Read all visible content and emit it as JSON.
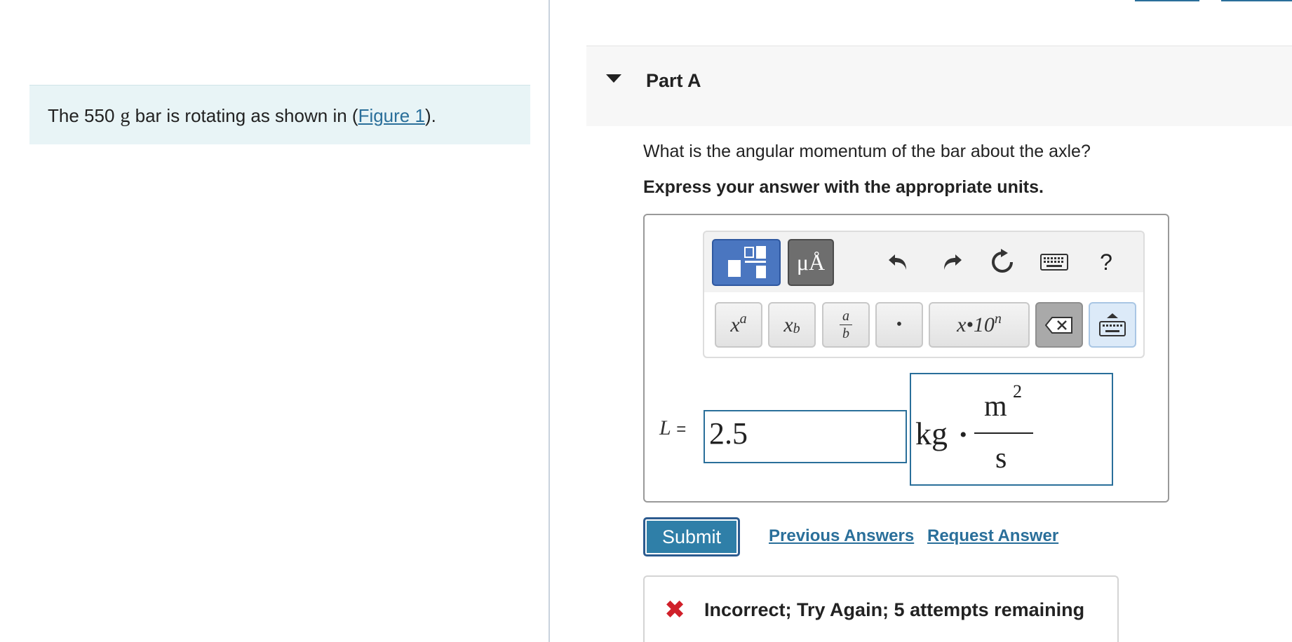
{
  "problem": {
    "intro_prefix": "The 550",
    "intro_unit": "g",
    "intro_middle": " bar is rotating as shown in (",
    "figure_link": "Figure 1",
    "intro_suffix": ")."
  },
  "part": {
    "title": "Part A",
    "question": "What is the angular momentum of the bar about the axle?",
    "instruction": "Express your answer with the appropriate units."
  },
  "toolbar": {
    "symbols_label": "μÅ",
    "help_label": "?",
    "keys": {
      "superscript_base": "x",
      "superscript_exp": "a",
      "subscript_base": "x",
      "subscript_sub": "b",
      "fraction_num": "a",
      "fraction_den": "b",
      "dot": "•",
      "sci_notation": "x•10",
      "sci_exp": "n"
    },
    "icons": [
      "templates-icon",
      "undo-icon",
      "redo-icon",
      "reset-icon",
      "keyboard-icon",
      "help-icon",
      "backspace-icon",
      "keyboard-toggle-icon"
    ]
  },
  "answer": {
    "variable": "L",
    "equals": "=",
    "value": "2.5",
    "unit_main": "kg",
    "unit_dot": "•",
    "unit_num": "m",
    "unit_num_exp": "2",
    "unit_den": "s"
  },
  "actions": {
    "submit_label": "Submit",
    "previous_answers": "Previous Answers",
    "request_answer": "Request Answer"
  },
  "feedback": {
    "icon": "✖",
    "message": "Incorrect; Try Again; 5 attempts remaining"
  },
  "colors": {
    "accent": "#2a6f9a",
    "intro_bg": "#e8f4f6",
    "submit_bg": "#2f7fa8",
    "error": "#d0202a",
    "templates_btn": "#4a76c0"
  }
}
